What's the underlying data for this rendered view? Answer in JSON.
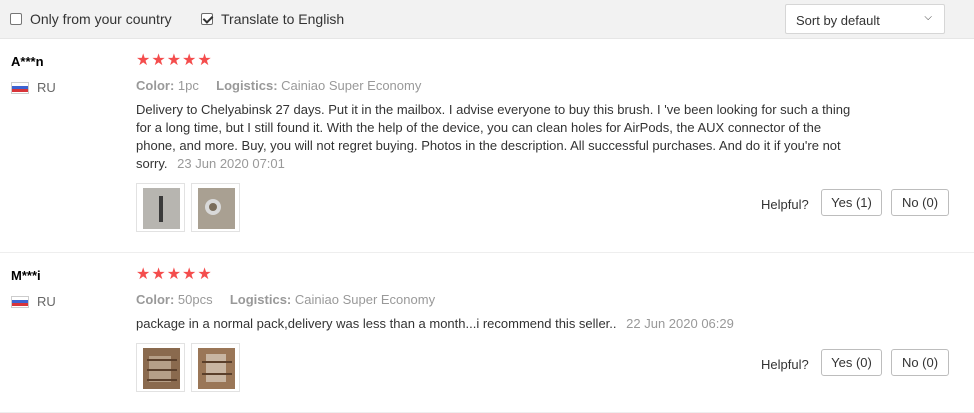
{
  "filters": {
    "only_country": {
      "label": "Only from your country",
      "checked": false
    },
    "translate": {
      "label": "Translate to English",
      "checked": true
    }
  },
  "sort": {
    "value": "Sort by default"
  },
  "reviews": [
    {
      "user": "A***n",
      "country": "RU",
      "rating": 5,
      "color_label": "Color:",
      "color": "1pc",
      "logistics_label": "Logistics:",
      "logistics": "Cainiao Super Economy",
      "text": "Delivery to Chelyabinsk 27 days. Put it in the mailbox. I advise everyone to buy this brush. I 've been looking for such a thing for a long time, but I still found it. With the help of the device, you can clean holes for AirPods, the AUX connector of the phone, and more. Buy, you will not regret buying. Photos in the description. All successful purchases. And do it if you're not sorry.",
      "date": "23 Jun 2020 07:01",
      "photos": 2,
      "helpful_label": "Helpful?",
      "yes_label": "Yes (1)",
      "no_label": "No (0)"
    },
    {
      "user": "M***i",
      "country": "RU",
      "rating": 5,
      "color_label": "Color:",
      "color": "50pcs",
      "logistics_label": "Logistics:",
      "logistics": "Cainiao Super Economy",
      "text": "package in a normal pack,delivery was less than a month...i recommend this seller..",
      "date": "22 Jun 2020 06:29",
      "photos": 2,
      "helpful_label": "Helpful?",
      "yes_label": "Yes (0)",
      "no_label": "No (0)"
    }
  ],
  "colors": {
    "star": "#f44d4d",
    "muted": "#999999",
    "text": "#333333"
  },
  "icons": {
    "star": "star-icon",
    "flag": "russia-flag-icon",
    "sort": "chevron-down-icon",
    "checkbox": "checkbox-icon"
  }
}
